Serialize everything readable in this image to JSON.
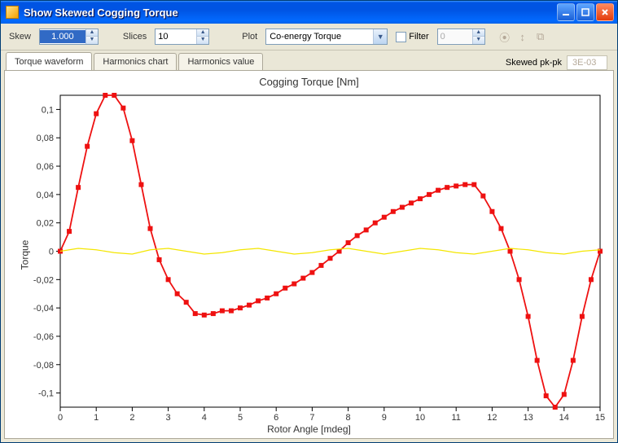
{
  "window": {
    "title": "Show Skewed Cogging Torque"
  },
  "toolbar": {
    "skew_label": "Skew",
    "skew_value": "1.000",
    "slices_label": "Slices",
    "slices_value": "10",
    "plot_label": "Plot",
    "plot_selected": "Co-energy Torque",
    "filter_label": "Filter",
    "filter_value": "0"
  },
  "tabs": {
    "items": [
      "Torque waveform",
      "Harmonics chart",
      "Harmonics value"
    ],
    "active": 0,
    "pkpk_label": "Skewed pk-pk",
    "pkpk_value": "3E-03"
  },
  "chart_data": {
    "type": "line",
    "title": "Cogging Torque [Nm]",
    "xlabel": "Rotor Angle [mdeg]",
    "ylabel": "Torque",
    "xlim": [
      0,
      15
    ],
    "ylim": [
      -0.11,
      0.11
    ],
    "xticks": [
      0,
      1,
      2,
      3,
      4,
      5,
      6,
      7,
      8,
      9,
      10,
      11,
      12,
      13,
      14,
      15
    ],
    "yticks": [
      -0.1,
      -0.08,
      -0.06,
      -0.04,
      -0.02,
      0,
      0.02,
      0.04,
      0.06,
      0.08,
      0.1
    ],
    "ytick_labels": [
      "-0,1",
      "-0,08",
      "-0,06",
      "-0,04",
      "-0,02",
      "0",
      "0,02",
      "0,04",
      "0,06",
      "0,08",
      "0,1"
    ],
    "series": [
      {
        "name": "Red torque",
        "color": "#e11",
        "marker": "square",
        "x": [
          0,
          0.25,
          0.5,
          0.75,
          1.0,
          1.25,
          1.5,
          1.75,
          2.0,
          2.25,
          2.5,
          2.75,
          3.0,
          3.25,
          3.5,
          3.75,
          4.0,
          4.25,
          4.5,
          4.75,
          5.0,
          5.25,
          5.5,
          5.75,
          6.0,
          6.25,
          6.5,
          6.75,
          7.0,
          7.25,
          7.5,
          7.75,
          8.0,
          8.25,
          8.5,
          8.75,
          9.0,
          9.25,
          9.5,
          9.75,
          10.0,
          10.25,
          10.5,
          10.75,
          11.0,
          11.25,
          11.5,
          11.75,
          12.0,
          12.25,
          12.5,
          12.75,
          13.0,
          13.25,
          13.5,
          13.75,
          14.0,
          14.25,
          14.5,
          14.75,
          15.0
        ],
        "y": [
          0.0,
          0.014,
          0.045,
          0.074,
          0.097,
          0.11,
          0.11,
          0.101,
          0.078,
          0.047,
          0.016,
          -0.006,
          -0.02,
          -0.03,
          -0.036,
          -0.044,
          -0.045,
          -0.044,
          -0.042,
          -0.042,
          -0.04,
          -0.038,
          -0.035,
          -0.033,
          -0.03,
          -0.026,
          -0.023,
          -0.019,
          -0.015,
          -0.01,
          -0.005,
          0.0,
          0.006,
          0.011,
          0.015,
          0.02,
          0.024,
          0.028,
          0.031,
          0.034,
          0.037,
          0.04,
          0.043,
          0.045,
          0.046,
          0.047,
          0.047,
          0.039,
          0.028,
          0.016,
          0.0,
          -0.02,
          -0.046,
          -0.077,
          -0.102,
          -0.11,
          -0.101,
          -0.077,
          -0.046,
          -0.02,
          0.0
        ]
      },
      {
        "name": "Yellow baseline",
        "color": "#f4e600",
        "marker": "none",
        "x": [
          0,
          0.5,
          1.0,
          1.5,
          2.0,
          2.5,
          3.0,
          3.5,
          4.0,
          4.5,
          5.0,
          5.5,
          6.0,
          6.5,
          7.0,
          7.5,
          8.0,
          8.5,
          9.0,
          9.5,
          10.0,
          10.5,
          11.0,
          11.5,
          12.0,
          12.5,
          13.0,
          13.5,
          14.0,
          14.5,
          15.0
        ],
        "y": [
          0.0,
          0.002,
          0.001,
          -0.001,
          -0.002,
          0.001,
          0.002,
          0.0,
          -0.002,
          -0.001,
          0.001,
          0.002,
          0.0,
          -0.002,
          -0.001,
          0.001,
          0.002,
          0.0,
          -0.002,
          0.0,
          0.002,
          0.001,
          -0.001,
          -0.002,
          0.0,
          0.002,
          0.001,
          -0.001,
          -0.002,
          0.0,
          0.001
        ]
      }
    ]
  }
}
